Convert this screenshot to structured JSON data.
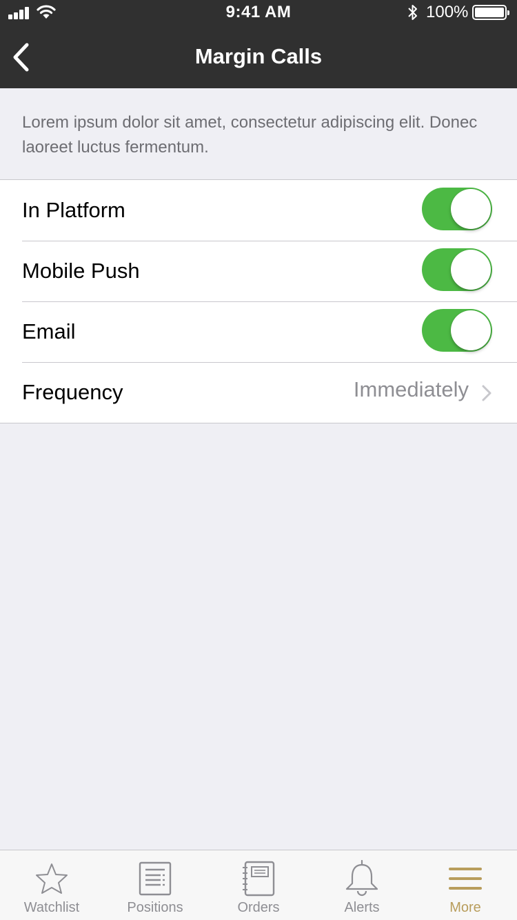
{
  "status_bar": {
    "time": "9:41 AM",
    "battery_percent": "100%",
    "icons": [
      "signal-icon",
      "wifi-icon",
      "bluetooth-icon",
      "battery-icon"
    ]
  },
  "nav": {
    "title": "Margin Calls",
    "back_icon": "chevron-left-icon"
  },
  "description": "Lorem ipsum dolor sit amet, consectetur adipiscing elit. Donec laoreet luctus fermentum.",
  "settings": {
    "in_platform": {
      "label": "In Platform",
      "enabled": true
    },
    "mobile_push": {
      "label": "Mobile Push",
      "enabled": true
    },
    "email": {
      "label": "Email",
      "enabled": true
    },
    "frequency": {
      "label": "Frequency",
      "value": "Immediately"
    }
  },
  "tabbar": {
    "items": [
      {
        "label": "Watchlist",
        "icon": "star-icon",
        "active": false
      },
      {
        "label": "Positions",
        "icon": "document-list-icon",
        "active": false
      },
      {
        "label": "Orders",
        "icon": "notebook-icon",
        "active": false
      },
      {
        "label": "Alerts",
        "icon": "bell-icon",
        "active": false
      },
      {
        "label": "More",
        "icon": "menu-icon",
        "active": true
      }
    ]
  },
  "colors": {
    "nav_background": "#303030",
    "toggle_on": "#4cb944",
    "active_tab": "#b89d5c",
    "inactive_tab": "#8e8e93",
    "page_background": "#efeff4"
  }
}
